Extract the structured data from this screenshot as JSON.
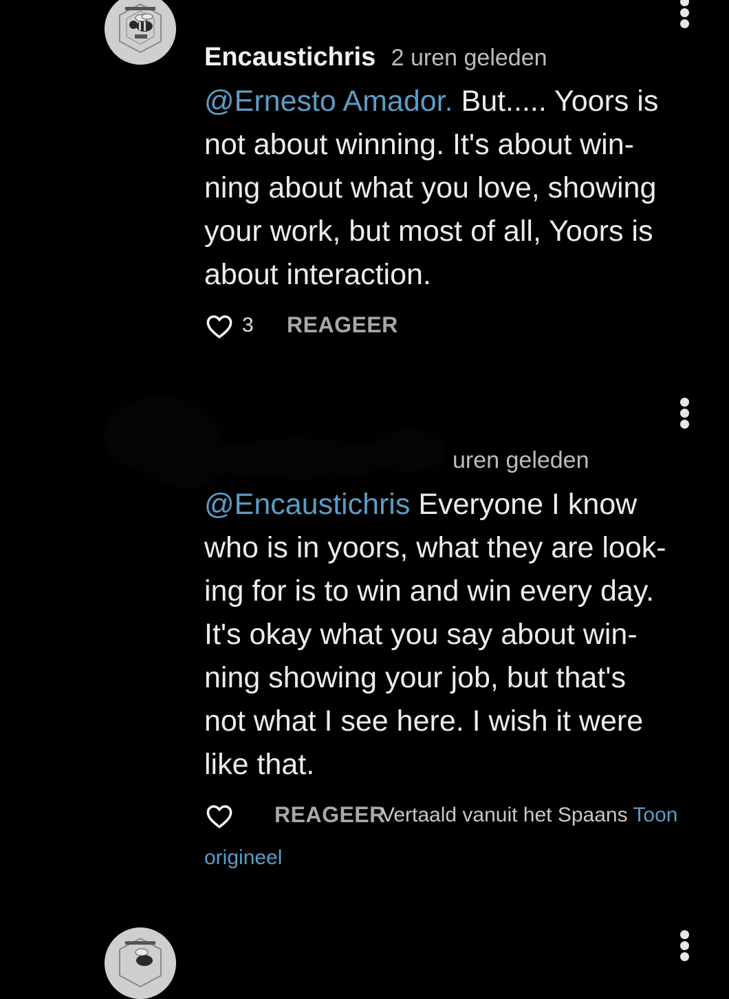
{
  "comments": [
    {
      "author": "Encaustichris",
      "time": "2 uren geleden",
      "mention": "@Ernesto Amador.",
      "lines": [
        " But..... Yoors is",
        "not about winning. It's about win-",
        "ning about what you love, showing",
        "your work, but most of all, Yoors is",
        "about interaction."
      ],
      "likes": "3",
      "reply_label": "REAGEER"
    },
    {
      "author": "",
      "time": "uren geleden",
      "mention": "@Encaustichris",
      "lines": [
        " Everyone I know",
        "who is in yoors, what they are look-",
        "ing for is to win and win every day.",
        "It's okay what you say about win-",
        "ning showing your job, but that's",
        "not what I see here. I wish it were",
        "like that."
      ],
      "reply_label": "REAGEER",
      "translated_label": "Vertaald vanuit het Spaans",
      "show_original_part1": "Toon",
      "show_original_part2": "origineel"
    }
  ],
  "icons": {
    "more": "more-vertical-icon",
    "like": "heart-outline-icon",
    "avatar": "bee-logo-avatar"
  },
  "colors": {
    "background": "#000000",
    "mention": "#5d9cc4",
    "text": "#ececec",
    "muted": "#a8a8a8"
  }
}
